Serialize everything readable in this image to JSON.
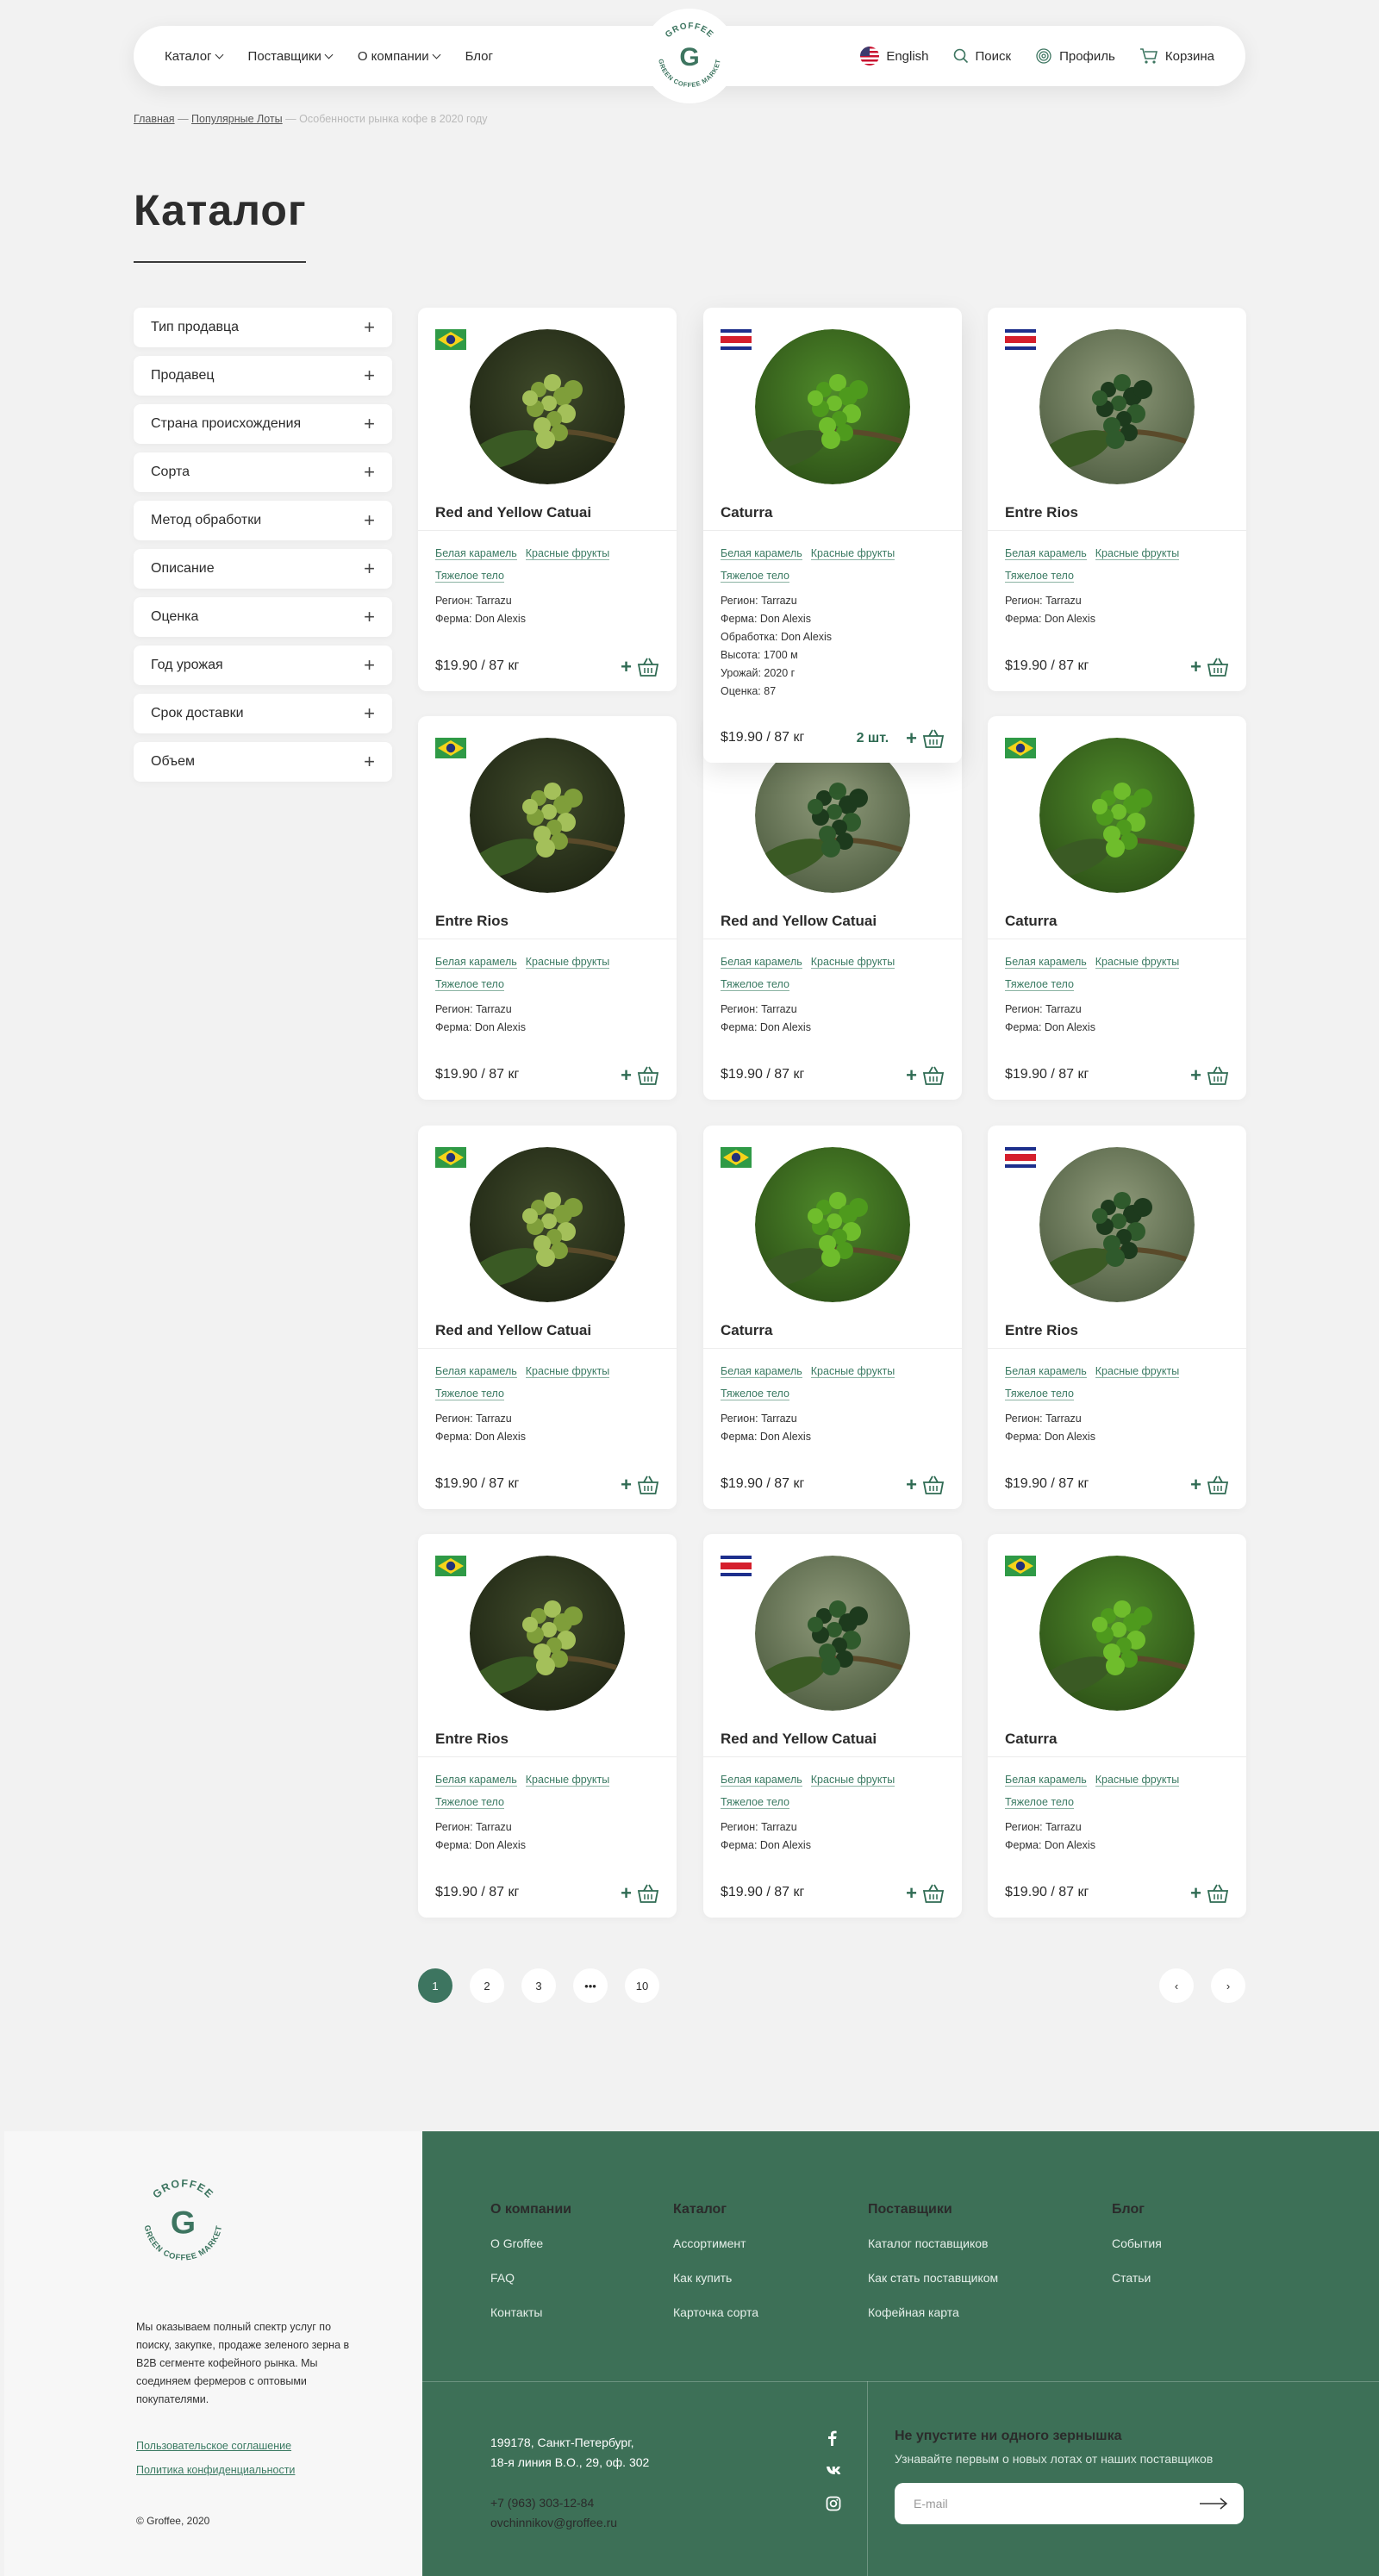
{
  "header": {
    "nav": [
      {
        "label": "Каталог",
        "dropdown": true
      },
      {
        "label": "Поставщики",
        "dropdown": true
      },
      {
        "label": "О компании",
        "dropdown": true
      },
      {
        "label": "Блог",
        "dropdown": false
      }
    ],
    "logo_text_top": "GROFFEE",
    "logo_text_bottom": "GREEN COFFEE MARKET",
    "logo_letter": "G",
    "language": "English",
    "search": "Поиск",
    "profile": "Профиль",
    "cart": "Корзина"
  },
  "breadcrumb": {
    "home": "Главная",
    "sep1": "—",
    "section": "Популярные Лоты",
    "sep2": "—",
    "current": "Особенности рынка кофе в 2020 году"
  },
  "page_title": "Каталог",
  "filters": [
    "Тип продавца",
    "Продавец",
    "Страна происхождения",
    "Сорта",
    "Метод обработки",
    "Описание",
    "Оценка",
    "Год урожая",
    "Срок доставки",
    "Объем"
  ],
  "card_common": {
    "tag1": "Белая карамель",
    "tag2": "Красные фрукты",
    "tag3": "Тяжелое тело",
    "region": "Регион: Tarrazu",
    "farm": "Ферма: Don Alexis",
    "price": "$19.90 / 87 кг",
    "plus": "+"
  },
  "expanded_specs": {
    "processing": "Обработка: Don Alexis",
    "altitude": "Высота: 1700 м",
    "harvest": "Урожай: 2020 г",
    "score": "Оценка: 87",
    "qty": "2 шт."
  },
  "products": [
    {
      "name": "Red and Yellow Catuai",
      "flag": "brazil",
      "photo": "light"
    },
    {
      "name": "Caturra",
      "flag": "costa-rica",
      "photo": "bright"
    },
    {
      "name": "Entre Rios",
      "flag": "costa-rica",
      "photo": "dark"
    },
    {
      "name": "Entre Rios",
      "flag": "brazil",
      "photo": "light"
    },
    {
      "name": "Red and Yellow Catuai",
      "flag": "costa-rica",
      "photo": "dark"
    },
    {
      "name": "Caturra",
      "flag": "brazil",
      "photo": "bright"
    },
    {
      "name": "Red and Yellow Catuai",
      "flag": "brazil",
      "photo": "light"
    },
    {
      "name": "Caturra",
      "flag": "brazil",
      "photo": "bright"
    },
    {
      "name": "Entre Rios",
      "flag": "costa-rica",
      "photo": "dark"
    },
    {
      "name": "Entre Rios",
      "flag": "brazil",
      "photo": "light"
    },
    {
      "name": "Red and Yellow Catuai",
      "flag": "costa-rica",
      "photo": "dark"
    },
    {
      "name": "Caturra",
      "flag": "brazil",
      "photo": "bright"
    }
  ],
  "pagination": {
    "pages": [
      "1",
      "2",
      "3",
      "•••",
      "10"
    ],
    "active": "1",
    "prev": "‹",
    "next": "›"
  },
  "footer": {
    "logo_text_top": "GROFFEE",
    "logo_text_bottom": "GREEN COFFEE MARKET",
    "logo_letter": "G",
    "description": "Мы оказываем полный спектр услуг по поиску, закупке, продаже зеленого зерна в B2B сегменте кофейного рынка. Мы соединяем фермеров с оптовыми покупателями.",
    "terms": "Пользовательское соглашение",
    "privacy": "Политика конфиденциальности",
    "copyright": "© Groffee, 2020",
    "columns": [
      {
        "title": "О компании",
        "links": [
          "О Groffee",
          "FAQ",
          "Контакты"
        ]
      },
      {
        "title": "Каталог",
        "links": [
          "Ассортимент",
          "Как купить",
          "Карточка сорта"
        ]
      },
      {
        "title": "Поставщики",
        "links": [
          "Каталог поставщиков",
          "Как стать поставщиком",
          "Кофейная карта"
        ]
      },
      {
        "title": "Блог",
        "links": [
          "События",
          "Статьи"
        ]
      }
    ],
    "address_line1": "199178, Санкт-Петербург,",
    "address_line2": "18-я линия В.О., 29, оф. 302",
    "phone": "+7 (963) 303-12-84",
    "email": "ovchinnikov@groffee.ru",
    "social": [
      "f",
      "vk",
      "ig"
    ],
    "newsletter_title": "Не упустите ни одного зернышка",
    "newsletter_sub": "Узнавайте первым о новых лотах от наших поставщиков",
    "email_placeholder": "E-mail"
  },
  "colors": {
    "brand": "#3d7057",
    "accent_link": "#3a7a62"
  }
}
